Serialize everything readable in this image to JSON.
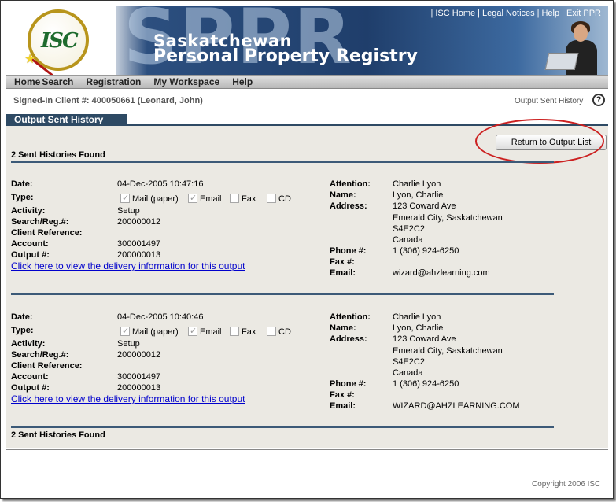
{
  "header": {
    "logo_text": "ISC",
    "big_text": "SPPR",
    "title_line1": "Saskatchewan",
    "title_line2": "Personal Property Registry",
    "links": [
      "ISC Home",
      "Legal Notices",
      "Help",
      "Exit PPR"
    ]
  },
  "nav": [
    "Home",
    "Search",
    "Registration",
    "My Workspace",
    "Help"
  ],
  "signed_in": "Signed-In Client #: 400050661 (Leonard, John)",
  "page_link": "Output Sent History",
  "help_icon_text": "?",
  "tab_title": "Output Sent History",
  "return_button": "Return to Output List",
  "found_text": "2 Sent Histories Found",
  "labels": {
    "date": "Date:",
    "type": "Type:",
    "activity": "Activity:",
    "search_reg": "Search/Reg.#:",
    "client_ref": "Client Reference:",
    "account": "Account:",
    "output": "Output #:",
    "attention": "Attention:",
    "name": "Name:",
    "address": "Address:",
    "phone": "Phone #:",
    "fax": "Fax #:",
    "email": "Email:"
  },
  "type_options": [
    "Mail (paper)",
    "Email",
    "Fax",
    "CD"
  ],
  "records": [
    {
      "date": "04-Dec-2005 10:47:16",
      "type_checked": [
        true,
        true,
        false,
        false
      ],
      "activity": "Setup",
      "search_reg": "200000012",
      "client_ref": "",
      "account": "300001497",
      "output": "200000013",
      "link": "Click here to view the delivery information for this output",
      "attention": "Charlie Lyon",
      "name": "Lyon, Charlie",
      "address1": "123 Coward Ave",
      "address2": "Emerald City, Saskatchewan",
      "address3": "S4E2C2",
      "address4": "Canada",
      "phone": "1 (306) 924-6250",
      "fax": "",
      "email": "wizard@ahzlearning.com"
    },
    {
      "date": "04-Dec-2005 10:40:46",
      "type_checked": [
        true,
        true,
        false,
        false
      ],
      "activity": "Setup",
      "search_reg": "200000012",
      "client_ref": "",
      "account": "300001497",
      "output": "200000013",
      "link": "Click here to view the delivery information for this output",
      "attention": "Charlie Lyon",
      "name": "Lyon, Charlie",
      "address1": "123 Coward Ave",
      "address2": "Emerald City, Saskatchewan",
      "address3": "S4E2C2",
      "address4": "Canada",
      "phone": "1 (306) 924-6250",
      "fax": "",
      "email": "WIZARD@AHZLEARNING.COM"
    }
  ],
  "copyright": "Copyright 2006 ISC",
  "colors": {
    "nav_tab": "#2e4a64",
    "highlight": "#cc2020",
    "link": "#0000cc"
  }
}
